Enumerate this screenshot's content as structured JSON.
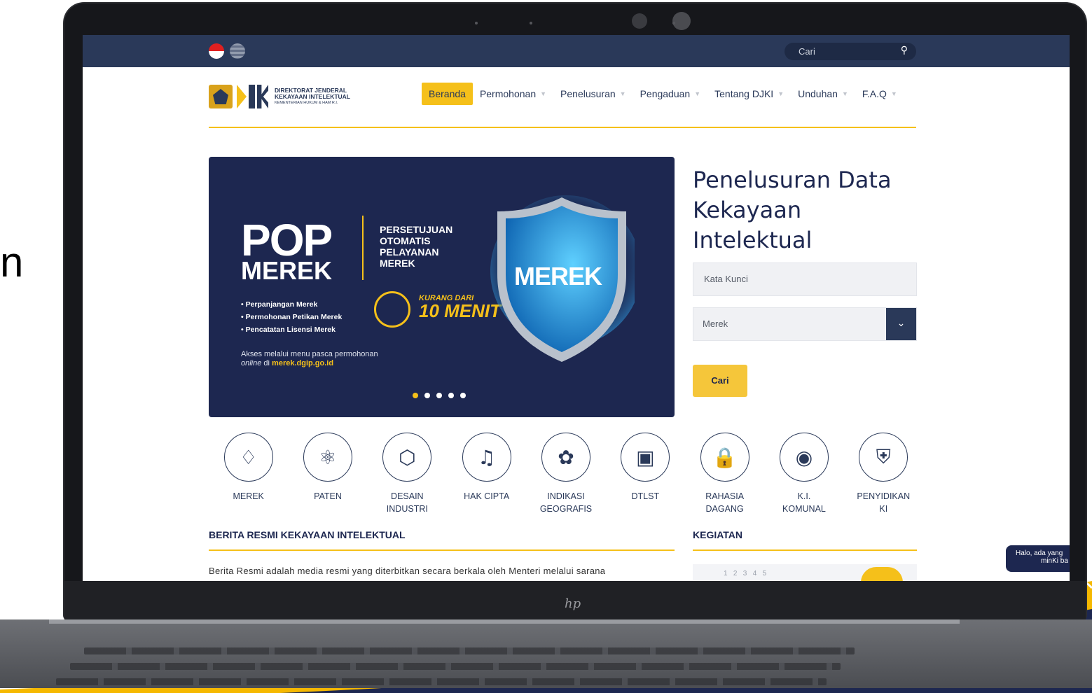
{
  "topbar": {
    "search_placeholder": "Cari"
  },
  "logo": {
    "line1": "DIREKTORAT JENDERAL",
    "line2": "KEKAYAAN INTELEKTUAL",
    "line3": "KEMENTERIAN HUKUM & HAM R.I."
  },
  "nav": {
    "items": [
      {
        "label": "Beranda"
      },
      {
        "label": "Permohonan"
      },
      {
        "label": "Penelusuran"
      },
      {
        "label": "Pengaduan"
      },
      {
        "label": "Tentang DJKI"
      },
      {
        "label": "Unduhan"
      },
      {
        "label": "F.A.Q"
      }
    ]
  },
  "banner": {
    "pop": "POP",
    "merek": "MEREK",
    "tagline": "PERSETUJUAN\nOTOMATIS\nPELAYANAN\nMEREK",
    "bullets": [
      "• Perpanjangan Merek",
      "• Permohonan Petikan Merek",
      "• Pencatatan Lisensi Merek"
    ],
    "akses_1": "Akses melalui menu pasca permohonan",
    "akses_italic": "online",
    "akses_di": " di ",
    "akses_link": "merek.dgip.go.id",
    "kurang_1": "KURANG DARI",
    "kurang_2": "10 MENIT",
    "shield_label": "MEREK",
    "slides": 5,
    "active_slide": 1
  },
  "search": {
    "title": "Penelusuran Data Kekayaan Intelektual",
    "keyword_placeholder": "Kata Kunci",
    "type_value": "Merek",
    "button": "Cari"
  },
  "categories": [
    {
      "label": "MEREK",
      "icon": "tag-icon"
    },
    {
      "label": "PATEN",
      "icon": "atom-icon"
    },
    {
      "label": "DESAIN\nINDUSTRI",
      "icon": "cube-icon"
    },
    {
      "label": "HAK CIPTA",
      "icon": "music-icon"
    },
    {
      "label": "INDIKASI\nGEOGRAFIS",
      "icon": "sprout-icon"
    },
    {
      "label": "DTLST",
      "icon": "chip-icon"
    },
    {
      "label": "RAHASIA\nDAGANG",
      "icon": "lock-icon"
    },
    {
      "label": "K.I.\nKOMUNAL",
      "icon": "mask-icon"
    },
    {
      "label": "PENYIDIKAN\nKI",
      "icon": "badge-icon"
    }
  ],
  "berita": {
    "title": "BERITA RESMI KEKAYAAN INTELEKTUAL",
    "text": "Berita Resmi adalah media resmi yang diterbitkan secara berkala oleh Menteri melalui sarana"
  },
  "kegiatan": {
    "title": "KEGIATAN",
    "calendar_numbers": "1   2   3   4   5"
  },
  "chat": {
    "line1": "Halo, ada yang",
    "line2": "minKi ba"
  },
  "colors": {
    "navy": "#2a3959",
    "banner": "#1d2750",
    "accent": "#f5c01a"
  }
}
